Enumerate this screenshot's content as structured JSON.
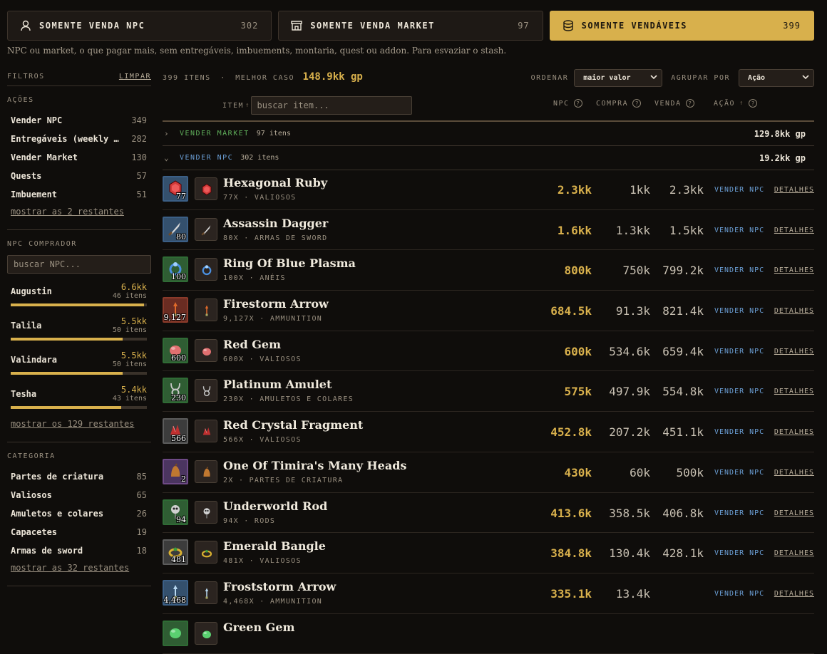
{
  "modes": [
    {
      "label": "SOMENTE VENDA NPC",
      "count": "302",
      "icon": "person-icon",
      "active": false
    },
    {
      "label": "SOMENTE VENDA MARKET",
      "count": "97",
      "icon": "shop-icon",
      "active": false
    },
    {
      "label": "SOMENTE VENDÁVEIS",
      "count": "399",
      "icon": "coins-icon",
      "active": true
    }
  ],
  "description": "NPC ou market, o que pagar mais, sem entregáveis, imbuements, montaria, quest ou addon. Para esvaziar o stash.",
  "sidebar": {
    "filters_label": "FILTROS",
    "clear_label": "LIMPAR",
    "actions": {
      "title": "AÇÕES",
      "items": [
        {
          "label": "Vender NPC",
          "count": "349"
        },
        {
          "label": "Entregáveis (weekly …",
          "count": "282"
        },
        {
          "label": "Vender Market",
          "count": "130"
        },
        {
          "label": "Quests",
          "count": "57"
        },
        {
          "label": "Imbuement",
          "count": "51"
        }
      ],
      "more": "mostrar as 2 restantes"
    },
    "npc": {
      "title": "NPC COMPRADOR",
      "placeholder": "buscar NPC...",
      "items": [
        {
          "name": "Augustin",
          "value": "6.6kk",
          "items": "46 itens",
          "fill": 0.98
        },
        {
          "name": "Talila",
          "value": "5.5kk",
          "items": "50 itens",
          "fill": 0.82
        },
        {
          "name": "Valindara",
          "value": "5.5kk",
          "items": "50 itens",
          "fill": 0.82
        },
        {
          "name": "Tesha",
          "value": "5.4kk",
          "items": "43 itens",
          "fill": 0.81
        }
      ],
      "more": "mostrar os 129 restantes"
    },
    "category": {
      "title": "CATEGORIA",
      "items": [
        {
          "label": "Partes de criatura",
          "count": "85"
        },
        {
          "label": "Valiosos",
          "count": "65"
        },
        {
          "label": "Amuletos e colares",
          "count": "26"
        },
        {
          "label": "Capacetes",
          "count": "19"
        },
        {
          "label": "Armas de sword",
          "count": "18"
        }
      ],
      "more": "mostrar as 32 restantes"
    }
  },
  "main": {
    "items_count": "399 ITENS",
    "best_label": "MELHOR CASO",
    "best_value": "148.9kk gp",
    "sort_label": "ORDENAR",
    "sort_value": "maior valor",
    "group_label": "AGRUPAR POR",
    "group_value": "Ação",
    "item_label": "ITEM",
    "search_placeholder": "buscar item...",
    "col_npc": "NPC",
    "col_buy": "COMPRA",
    "col_sell": "VENDA",
    "col_action": "AÇÃO",
    "groups": [
      {
        "name": "VENDER MARKET",
        "count": "97 itens",
        "total": "129.8kk gp",
        "color": "#5fae5a",
        "expanded": false
      },
      {
        "name": "VENDER NPC",
        "count": "302 itens",
        "total": "19.2kk gp",
        "color": "#6b9fd6",
        "expanded": true
      }
    ],
    "rows": [
      {
        "name": "Hexagonal Ruby",
        "meta": "77X · VALIOSOS",
        "qty": "77",
        "best": "2.3kk",
        "buy": "1kk",
        "sell": "2.3kk",
        "frame": "blue",
        "icon": "ruby-icon",
        "color": "#d23a3a"
      },
      {
        "name": "Assassin Dagger",
        "meta": "80X · ARMAS DE SWORD",
        "qty": "80",
        "best": "1.6kk",
        "buy": "1.3kk",
        "sell": "1.5kk",
        "frame": "blue",
        "icon": "dagger-icon",
        "color": "#d8d8d8"
      },
      {
        "name": "Ring Of Blue Plasma",
        "meta": "100X · ANÉIS",
        "qty": "100",
        "best": "800k",
        "buy": "750k",
        "sell": "799.2k",
        "frame": "green",
        "icon": "ring-icon",
        "color": "#4a8fe0"
      },
      {
        "name": "Firestorm Arrow",
        "meta": "9,127X · AMMUNITION",
        "qty": "9,127",
        "best": "684.5k",
        "buy": "91.3k",
        "sell": "821.4k",
        "frame": "red",
        "icon": "arrow-icon",
        "color": "#e06a2a"
      },
      {
        "name": "Red Gem",
        "meta": "600X · VALIOSOS",
        "qty": "600",
        "best": "600k",
        "buy": "534.6k",
        "sell": "659.4k",
        "frame": "green",
        "icon": "gem-icon",
        "color": "#e07070"
      },
      {
        "name": "Platinum Amulet",
        "meta": "230X · AMULETOS E COLARES",
        "qty": "230",
        "best": "575k",
        "buy": "497.9k",
        "sell": "554.8k",
        "frame": "green",
        "icon": "amulet-icon",
        "color": "#c8c8c8"
      },
      {
        "name": "Red Crystal Fragment",
        "meta": "566X · VALIOSOS",
        "qty": "566",
        "best": "452.8k",
        "buy": "207.2k",
        "sell": "451.1k",
        "frame": "gray",
        "icon": "crystal-icon",
        "color": "#c03030"
      },
      {
        "name": "One Of Timira's Many Heads",
        "meta": "2X · PARTES DE CRIATURA",
        "qty": "2",
        "best": "430k",
        "buy": "60k",
        "sell": "500k",
        "frame": "purple",
        "icon": "head-icon",
        "color": "#c07830"
      },
      {
        "name": "Underworld Rod",
        "meta": "94X · RODS",
        "qty": "94",
        "best": "413.6k",
        "buy": "358.5k",
        "sell": "406.8k",
        "frame": "green",
        "icon": "skull-rod-icon",
        "color": "#d0d0d0"
      },
      {
        "name": "Emerald Bangle",
        "meta": "481X · VALIOSOS",
        "qty": "481",
        "best": "384.8k",
        "buy": "130.4k",
        "sell": "428.1k",
        "frame": "gray",
        "icon": "bangle-icon",
        "color": "#d8b030"
      },
      {
        "name": "Froststorm Arrow",
        "meta": "4,468X · AMMUNITION",
        "qty": "4,468",
        "best": "335.1k",
        "buy": "13.4k",
        "sell": "",
        "frame": "blue",
        "icon": "arrow-icon",
        "color": "#b8d8f0"
      },
      {
        "name": "Green Gem",
        "meta": "",
        "qty": "",
        "best": "",
        "buy": "",
        "sell": "",
        "frame": "green",
        "icon": "gem-icon",
        "color": "#5ad070"
      }
    ],
    "action_label": "VENDER NPC",
    "details_label": "DETALHES"
  }
}
